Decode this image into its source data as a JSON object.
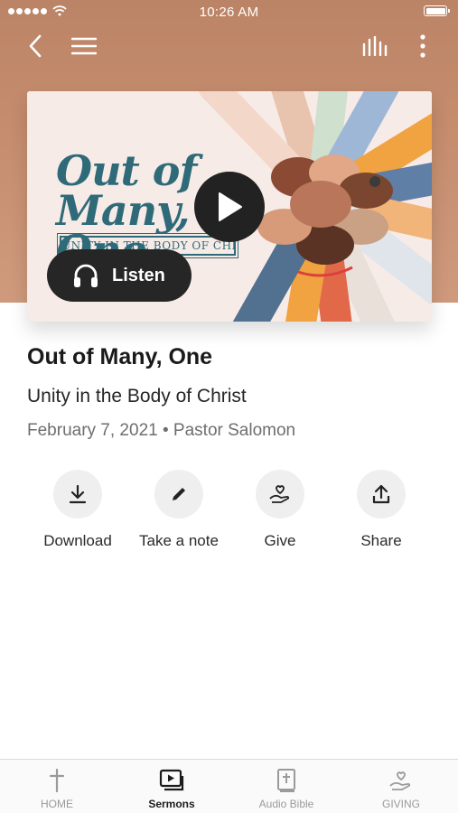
{
  "status_bar": {
    "time": "10:26 AM"
  },
  "artwork": {
    "title_line1": "Out of",
    "title_line2": "Many, One",
    "subtitle": "UNITY IN THE BODY OF CHRIST",
    "listen_label": "Listen"
  },
  "sermon": {
    "title": "Out of Many, One",
    "subtitle": "Unity in the Body of Christ",
    "date": "February 7, 2021",
    "separator": "•",
    "speaker": "Pastor Salomon"
  },
  "actions": [
    {
      "label": "Download",
      "icon": "download-icon"
    },
    {
      "label": "Take a note",
      "icon": "pencil-icon"
    },
    {
      "label": "Give",
      "icon": "give-hand-heart-icon"
    },
    {
      "label": "Share",
      "icon": "share-icon"
    }
  ],
  "tabs": [
    {
      "label": "HOME",
      "icon": "cross-icon",
      "active": false
    },
    {
      "label": "Sermons",
      "icon": "video-library-icon",
      "active": true
    },
    {
      "label": "Audio Bible",
      "icon": "bible-icon",
      "active": false
    },
    {
      "label": "GIVING",
      "icon": "hand-heart-icon",
      "active": false
    }
  ],
  "colors": {
    "hero": "#c68d6f",
    "accent_teal": "#2f6a79",
    "dark_button": "#262626"
  }
}
